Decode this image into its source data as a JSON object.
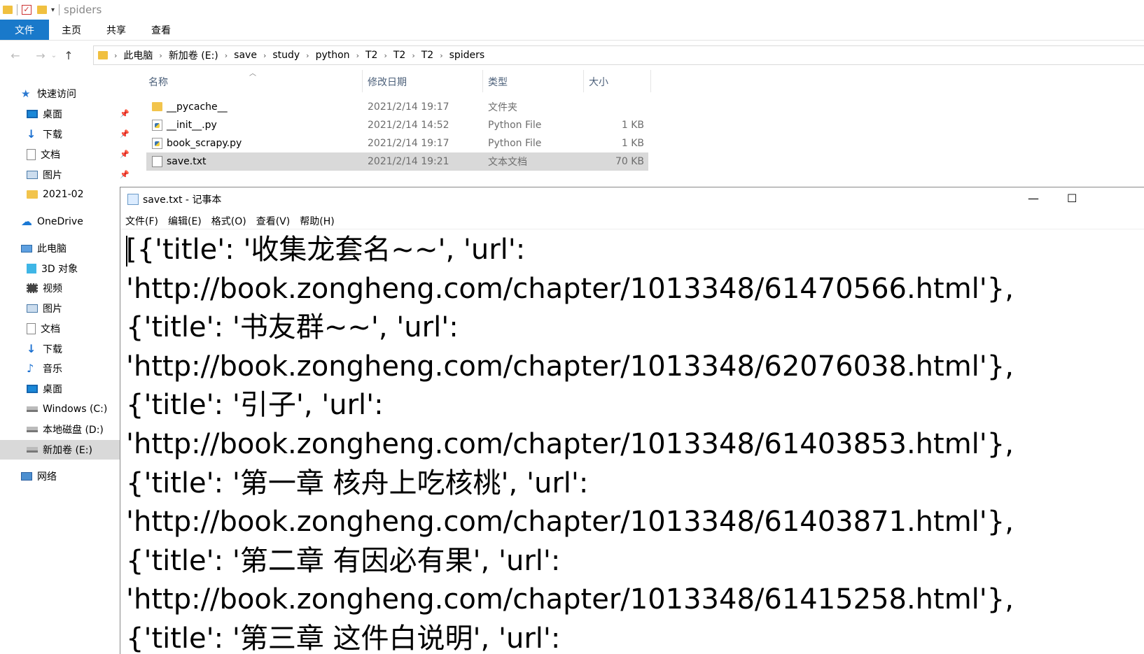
{
  "explorer": {
    "title": "spiders",
    "ribbon_tabs": [
      "文件",
      "主页",
      "共享",
      "查看"
    ],
    "breadcrumb": [
      "此电脑",
      "新加卷 (E:)",
      "save",
      "study",
      "python",
      "T2",
      "T2",
      "T2",
      "spiders"
    ],
    "columns": {
      "name": "名称",
      "date": "修改日期",
      "type": "类型",
      "size": "大小"
    },
    "files": [
      {
        "name": "__pycache__",
        "date": "2021/2/14 19:17",
        "type": "文件夹",
        "size": "",
        "icon": "folder-icon"
      },
      {
        "name": "__init__.py",
        "date": "2021/2/14 14:52",
        "type": "Python File",
        "size": "1 KB",
        "icon": "python-file-icon"
      },
      {
        "name": "book_scrapy.py",
        "date": "2021/2/14 19:17",
        "type": "Python File",
        "size": "1 KB",
        "icon": "python-file-icon"
      },
      {
        "name": "save.txt",
        "date": "2021/2/14 19:21",
        "type": "文本文档",
        "size": "70 KB",
        "icon": "text-file-icon",
        "selected": true
      }
    ],
    "sidebar": [
      {
        "label": "快速访问",
        "icon": "star-icon"
      },
      {
        "label": "桌面",
        "icon": "desktop-icon",
        "pinned": true
      },
      {
        "label": "下载",
        "icon": "download-icon",
        "pinned": true
      },
      {
        "label": "文档",
        "icon": "document-icon",
        "pinned": true
      },
      {
        "label": "图片",
        "icon": "pictures-icon",
        "pinned": true
      },
      {
        "label": "2021-02",
        "icon": "folder-icon"
      },
      {
        "label": "OneDrive",
        "icon": "onedrive-icon"
      },
      {
        "label": "此电脑",
        "icon": "this-pc-icon"
      },
      {
        "label": "3D 对象",
        "icon": "3d-objects-icon"
      },
      {
        "label": "视频",
        "icon": "videos-icon"
      },
      {
        "label": "图片",
        "icon": "pictures-icon"
      },
      {
        "label": "文档",
        "icon": "document-icon"
      },
      {
        "label": "下载",
        "icon": "download-icon"
      },
      {
        "label": "音乐",
        "icon": "music-icon"
      },
      {
        "label": "桌面",
        "icon": "desktop-icon"
      },
      {
        "label": "Windows (C:)",
        "icon": "drive-icon"
      },
      {
        "label": "本地磁盘 (D:)",
        "icon": "drive-icon"
      },
      {
        "label": "新加卷 (E:)",
        "icon": "drive-icon",
        "selected": true
      },
      {
        "label": "网络",
        "icon": "network-icon"
      }
    ]
  },
  "notepad": {
    "title": "save.txt - 记事本",
    "menu": [
      "文件(F)",
      "编辑(E)",
      "格式(O)",
      "查看(V)",
      "帮助(H)"
    ],
    "lines": [
      "[{'title': '收集龙套名~~', 'url':",
      "'http://book.zongheng.com/chapter/1013348/61470566.html'},",
      "{'title': '书友群~~', 'url':",
      "'http://book.zongheng.com/chapter/1013348/62076038.html'},",
      "{'title': '引子', 'url':",
      "'http://book.zongheng.com/chapter/1013348/61403853.html'},",
      "{'title': '第一章 核舟上吃核桃', 'url':",
      "'http://book.zongheng.com/chapter/1013348/61403871.html'},",
      "{'title': '第二章 有因必有果', 'url':",
      "'http://book.zongheng.com/chapter/1013348/61415258.html'},",
      "{'title': '第三章 这件白说明', 'url':"
    ]
  },
  "colors": {
    "accent": "#1979ca",
    "selection": "#d9d9d9"
  }
}
